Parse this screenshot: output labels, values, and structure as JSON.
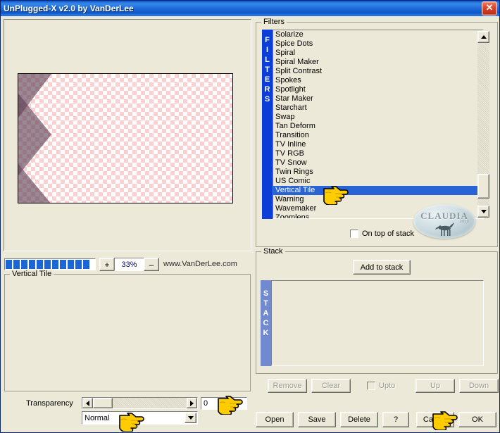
{
  "window": {
    "title": "UnPlugged-X v2.0 by VanDerLee",
    "close_label": "✕"
  },
  "preview": {
    "zoom_percent": "33%",
    "zoom_in_label": "+",
    "zoom_out_label": "–",
    "website": "www.VanDerLee.com",
    "progress_blocks": 11
  },
  "params_group": {
    "title": "Vertical Tile",
    "transparency_label": "Transparency",
    "transparency_value": "0",
    "blend_mode": "Normal",
    "slider_left_arrow": "◄",
    "slider_right_arrow": "►",
    "combo_arrow": "▼"
  },
  "filters": {
    "title": "Filters",
    "strip_label": "FILTERS",
    "selected": "Vertical Tile",
    "items": [
      "Solarize",
      "Spice Dots",
      "Spiral",
      "Spiral Maker",
      "Split Contrast",
      "Spokes",
      "Spotlight",
      "Star Maker",
      "Starchart",
      "Swap",
      "Tan Deform",
      "Transition",
      "TV Inline",
      "TV RGB",
      "TV Snow",
      "Twin Rings",
      "US Comic",
      "Vertical Tile",
      "Warning",
      "Wavemaker",
      "Zoomlens"
    ],
    "on_top_of_stack_label": "On top of stack",
    "on_top_of_stack_checked": false,
    "scroll_up_arrow": "▲",
    "scroll_down_arrow": "▼"
  },
  "watermark": {
    "text": "CLAUDIA",
    "subtext": "2013"
  },
  "stack": {
    "title": "Stack",
    "strip_label": "STACK",
    "add_label": "Add to stack",
    "items": [],
    "remove_label": "Remove",
    "clear_label": "Clear",
    "upto_label": "Upto",
    "upto_checked": false,
    "up_label": "Up",
    "down_label": "Down"
  },
  "bottom_buttons": {
    "open": "Open",
    "save": "Save",
    "delete": "Delete",
    "help": "?",
    "cancel": "Cancel",
    "ok": "OK"
  },
  "colors": {
    "titlebar_blue": "#1868dd",
    "selection_blue": "#2a63d5",
    "filters_strip": "#0b3ed6",
    "stack_strip": "#7189ce",
    "face": "#ece9d8",
    "progress": "#1b66d6",
    "close_red": "#d8452a"
  }
}
